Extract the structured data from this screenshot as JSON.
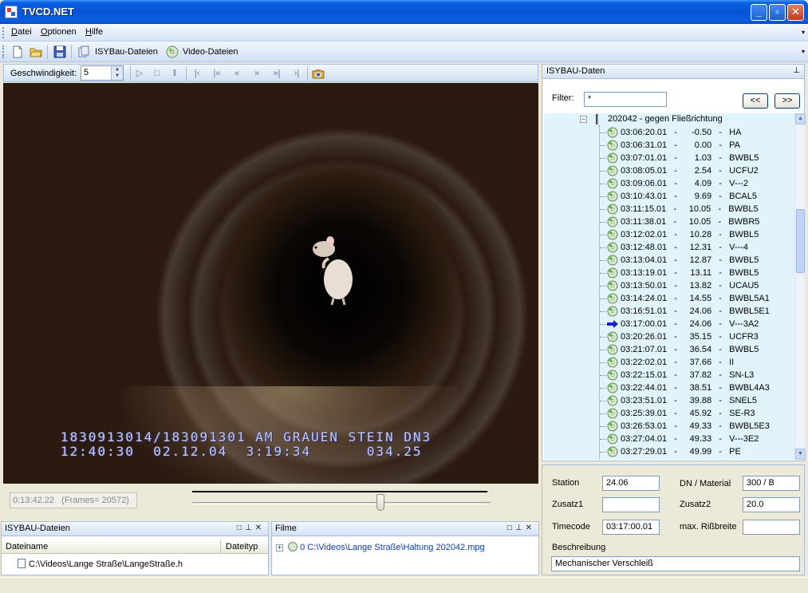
{
  "window": {
    "title": "TVCD.NET"
  },
  "menu": {
    "items": [
      "Datei",
      "Optionen",
      "Hilfe"
    ]
  },
  "toolbar": {
    "isybau_label": "ISYBau-Dateien",
    "video_label": "Video-Dateien"
  },
  "video_toolbar": {
    "speed_label": "Geschwindigkeit:",
    "speed_value": "5"
  },
  "video": {
    "osd_line1": "1830913014/183091301 AM GRAUEN STEIN DN3",
    "osd_line2": "12:40:30  02.12.04  3:19:34      034.25"
  },
  "position": {
    "time": "0:13:42.22",
    "frames": "(Frames= 20572)",
    "slider_fraction": 0.63
  },
  "isybau_files": {
    "title": "ISYBAU-Dateien",
    "col_filename": "Dateiname",
    "col_filetype": "Dateityp",
    "rows": [
      "C:\\Videos\\Lange Straße\\LangeStraße.h"
    ]
  },
  "filme": {
    "title": "Filme",
    "rows": [
      "0 C:\\Videos\\Lange Straße\\Haltung 202042.mpg"
    ]
  },
  "isybau_data": {
    "title": "ISYBAU-Daten",
    "filter_label": "Filter:",
    "filter_value": "*",
    "prev_label": "<<",
    "next_label": ">>",
    "root_label": "202042   -   gegen Fließrichtung",
    "rows": [
      {
        "time": "03:06:20.01",
        "meter": "-0.50",
        "code": "HA",
        "current": false
      },
      {
        "time": "03:06:31.01",
        "meter": "0.00",
        "code": "PA",
        "current": false
      },
      {
        "time": "03:07:01.01",
        "meter": "1.03",
        "code": "BWBL5",
        "current": false
      },
      {
        "time": "03:08:05.01",
        "meter": "2.54",
        "code": "UCFU2",
        "current": false
      },
      {
        "time": "03:09:06.01",
        "meter": "4.09",
        "code": "V---2",
        "current": false
      },
      {
        "time": "03:10:43.01",
        "meter": "9.69",
        "code": "BCAL5",
        "current": false
      },
      {
        "time": "03:11:15.01",
        "meter": "10.05",
        "code": "BWBL5",
        "current": false
      },
      {
        "time": "03:11:38.01",
        "meter": "10.05",
        "code": "BWBR5",
        "current": false
      },
      {
        "time": "03:12:02.01",
        "meter": "10.28",
        "code": "BWBL5",
        "current": false
      },
      {
        "time": "03:12:48.01",
        "meter": "12.31",
        "code": "V---4",
        "current": false
      },
      {
        "time": "03:13:04.01",
        "meter": "12.87",
        "code": "BWBL5",
        "current": false
      },
      {
        "time": "03:13:19.01",
        "meter": "13.11",
        "code": "BWBL5",
        "current": false
      },
      {
        "time": "03:13:50.01",
        "meter": "13.82",
        "code": "UCAU5",
        "current": false
      },
      {
        "time": "03:14:24.01",
        "meter": "14.55",
        "code": "BWBL5A1",
        "current": false
      },
      {
        "time": "03:16:51.01",
        "meter": "24.06",
        "code": "BWBL5E1",
        "current": false
      },
      {
        "time": "03:17:00.01",
        "meter": "24.06",
        "code": "V---3A2",
        "current": true
      },
      {
        "time": "03:20:26.01",
        "meter": "35.15",
        "code": "UCFR3",
        "current": false
      },
      {
        "time": "03:21:07.01",
        "meter": "36.54",
        "code": "BWBL5",
        "current": false
      },
      {
        "time": "03:22:02.01",
        "meter": "37.66",
        "code": "II",
        "current": false
      },
      {
        "time": "03:22:15.01",
        "meter": "37.82",
        "code": "SN-L3",
        "current": false
      },
      {
        "time": "03:22:44.01",
        "meter": "38.51",
        "code": "BWBL4A3",
        "current": false
      },
      {
        "time": "03:23:51.01",
        "meter": "39.88",
        "code": "SNEL5",
        "current": false
      },
      {
        "time": "03:25:39.01",
        "meter": "45.92",
        "code": "SE-R3",
        "current": false
      },
      {
        "time": "03:26:53.01",
        "meter": "49.33",
        "code": "BWBL5E3",
        "current": false
      },
      {
        "time": "03:27:04.01",
        "meter": "49.33",
        "code": "V---3E2",
        "current": false
      },
      {
        "time": "03:27:29.01",
        "meter": "49.99",
        "code": "PE",
        "current": false
      }
    ]
  },
  "detail": {
    "station_label": "Station",
    "station_value": "24.06",
    "dn_label": "DN / Material",
    "dn_value": "300 / B",
    "zusatz1_label": "Zusatz1",
    "zusatz1_value": "",
    "zusatz2_label": "Zusatz2",
    "zusatz2_value": "20.0",
    "timecode_label": "Timecode",
    "timecode_value": "03:17:00.01",
    "riss_label": "max. Rißbreite",
    "riss_value": "",
    "beschreibung_label": "Beschreibung",
    "beschreibung_value": "Mechanischer Verschleiß"
  },
  "colors": {
    "title_blue": "#0653d6",
    "tree_bg": "#e1f4fb",
    "current_arrow": "#1c1cd6",
    "link_blue": "#0a3ea8"
  }
}
